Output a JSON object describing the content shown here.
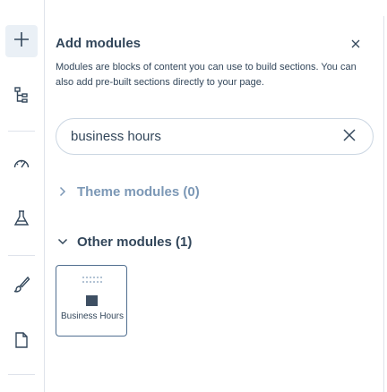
{
  "rail": {
    "items": [
      {
        "name": "add-icon",
        "active": true
      },
      {
        "name": "layers-tree-icon",
        "active": false
      },
      {
        "name": "speedometer-icon",
        "active": false
      },
      {
        "name": "flask-icon",
        "active": false
      },
      {
        "name": "paintbrush-icon",
        "active": false
      },
      {
        "name": "document-icon",
        "active": false
      }
    ]
  },
  "panel": {
    "title": "Add modules",
    "description": "Modules are blocks of content you can use to build sections. You can also add pre-built sections directly to your page.",
    "search": {
      "value": "business hours",
      "placeholder": ""
    },
    "sections": {
      "theme": {
        "label": "Theme modules (0)",
        "expanded": false
      },
      "other": {
        "label": "Other modules (1)",
        "expanded": true
      }
    },
    "modules": [
      {
        "label": "Business Hours",
        "icon": "square-icon"
      }
    ]
  },
  "colors": {
    "text": "#33475b",
    "muted": "#7c98b6",
    "border": "#cbd6e2",
    "active_bg": "#eaf0f6"
  }
}
